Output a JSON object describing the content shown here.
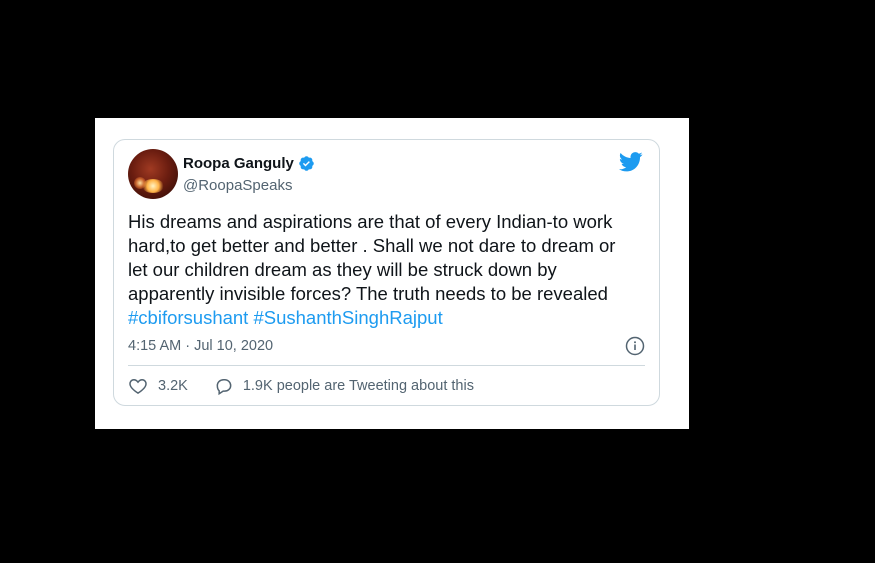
{
  "clipped_header_text": "~ ~ ~ ~ ~ ~ ~ ~ ~ ~ ~ ~ ~ ~ ~ ~ ~ ~ ~ ~ ~ ~ ~ ~ ~",
  "tweet": {
    "author": {
      "display_name": "Roopa Ganguly",
      "handle": "@RoopaSpeaks",
      "verified": true
    },
    "text_lines": [
      "His dreams and aspirations are that of every Indian-to work",
      "hard,to get better and better . Shall we not dare to dream or",
      "let our children dream as they will be struck down by",
      "apparently invisible forces? The truth needs to be revealed"
    ],
    "hashtags": [
      "#cbiforsushant",
      "#SushanthSinghRajput"
    ],
    "timestamp": "4:15 AM · Jul 10, 2020",
    "likes": "3.2K",
    "engagement_text": "1.9K people are Tweeting about this"
  },
  "colors": {
    "background": "#000000",
    "card_border": "#cfd9de",
    "link_blue": "#1d9bf0",
    "text_primary": "#0f1419",
    "text_secondary": "#536471"
  },
  "icons": {
    "verified": "verified-badge-icon",
    "brand": "twitter-bird-icon",
    "info": "info-icon",
    "like": "heart-icon",
    "reply": "speech-bubble-icon"
  }
}
